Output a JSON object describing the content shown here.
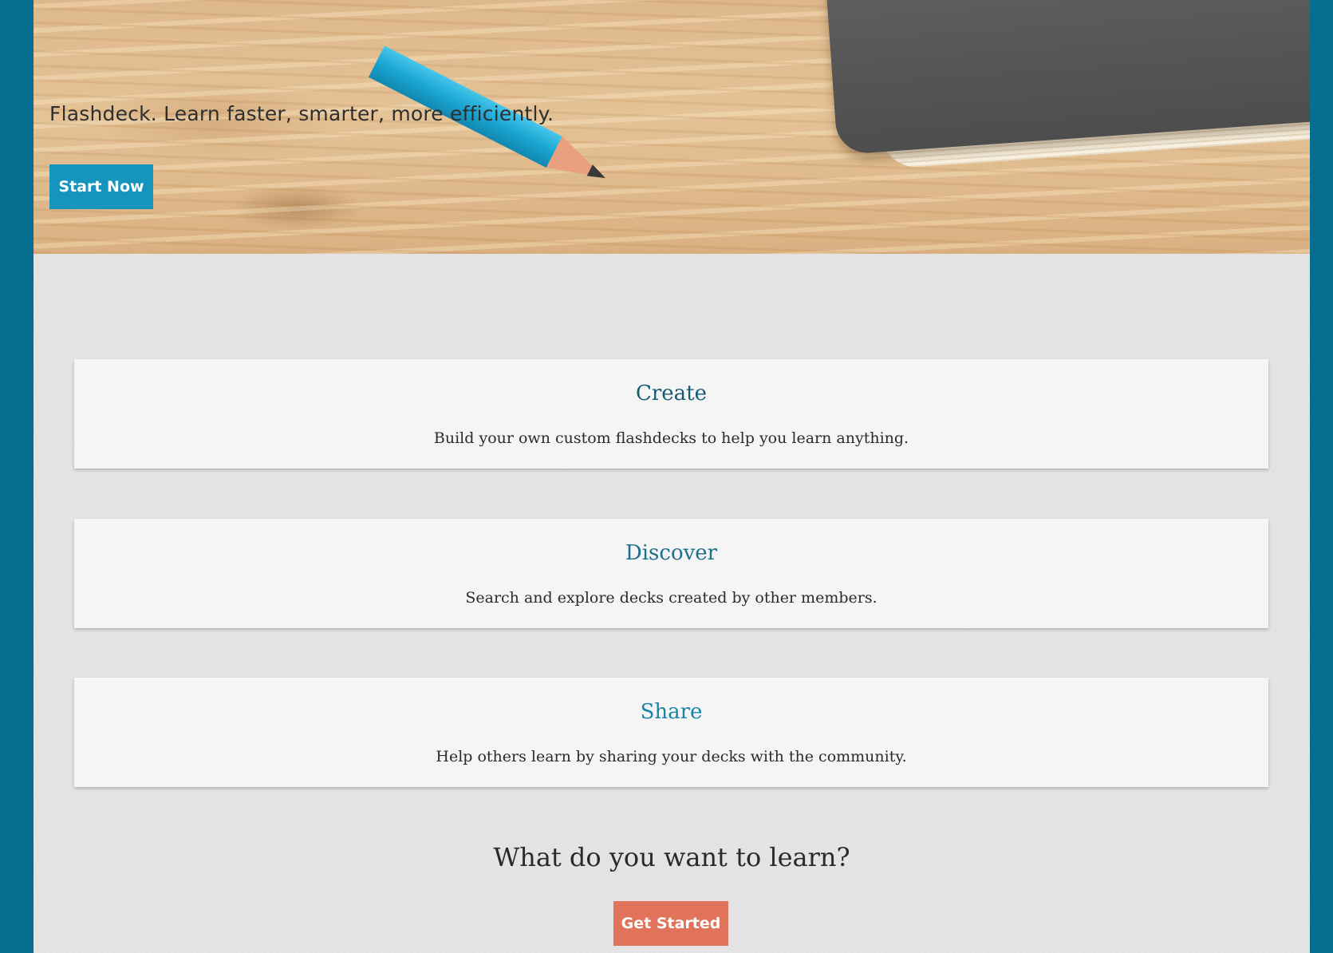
{
  "hero": {
    "tagline": "Flashdeck. Learn faster, smarter, more efficiently.",
    "start_button": "Start Now"
  },
  "features": [
    {
      "title": "Create",
      "description": "Build your own custom flashdecks to help you learn anything."
    },
    {
      "title": "Discover",
      "description": "Search and explore decks created by other members."
    },
    {
      "title": "Share",
      "description": "Help others learn by sharing your decks with the community."
    }
  ],
  "cta": {
    "question": "What do you want to learn?",
    "button": "Get Started"
  },
  "colors": {
    "frame": "#066f91",
    "start_button": "#1594bd",
    "get_started_button": "#e0735a"
  }
}
